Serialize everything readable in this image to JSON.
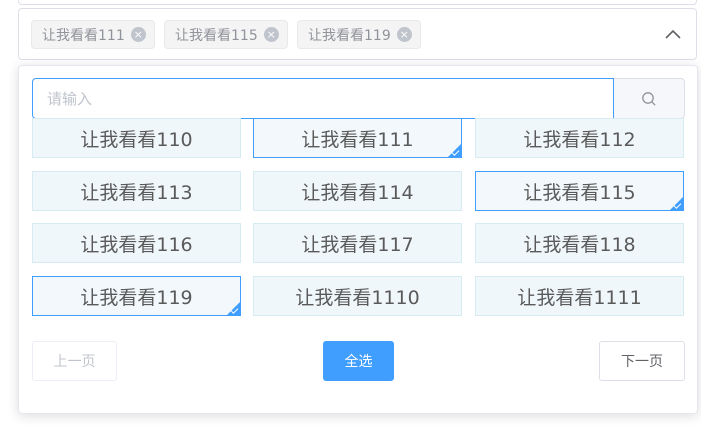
{
  "select": {
    "tags": [
      {
        "label": "让我看看111"
      },
      {
        "label": "让我看看115"
      },
      {
        "label": "让我看看119"
      }
    ],
    "close_glyph": "×"
  },
  "dropdown": {
    "search": {
      "placeholder": "请输入",
      "value": ""
    },
    "options": [
      {
        "label": "让我看看110",
        "selected": false
      },
      {
        "label": "让我看看111",
        "selected": true
      },
      {
        "label": "让我看看112",
        "selected": false
      },
      {
        "label": "让我看看113",
        "selected": false
      },
      {
        "label": "让我看看114",
        "selected": false
      },
      {
        "label": "让我看看115",
        "selected": true
      },
      {
        "label": "让我看看116",
        "selected": false
      },
      {
        "label": "让我看看117",
        "selected": false
      },
      {
        "label": "让我看看118",
        "selected": false
      },
      {
        "label": "让我看看119",
        "selected": true
      },
      {
        "label": "让我看看1110",
        "selected": false
      },
      {
        "label": "让我看看1111",
        "selected": false
      }
    ],
    "buttons": {
      "prev": "上一页",
      "select_all": "全选",
      "next": "下一页"
    }
  },
  "colors": {
    "accent": "#409eff",
    "option_bg": "#f0f7fa",
    "tag_bg": "#f4f4f5"
  },
  "icons": {
    "search": "search-icon",
    "arrow": "chevron-up-icon",
    "tag_close": "close-icon"
  }
}
